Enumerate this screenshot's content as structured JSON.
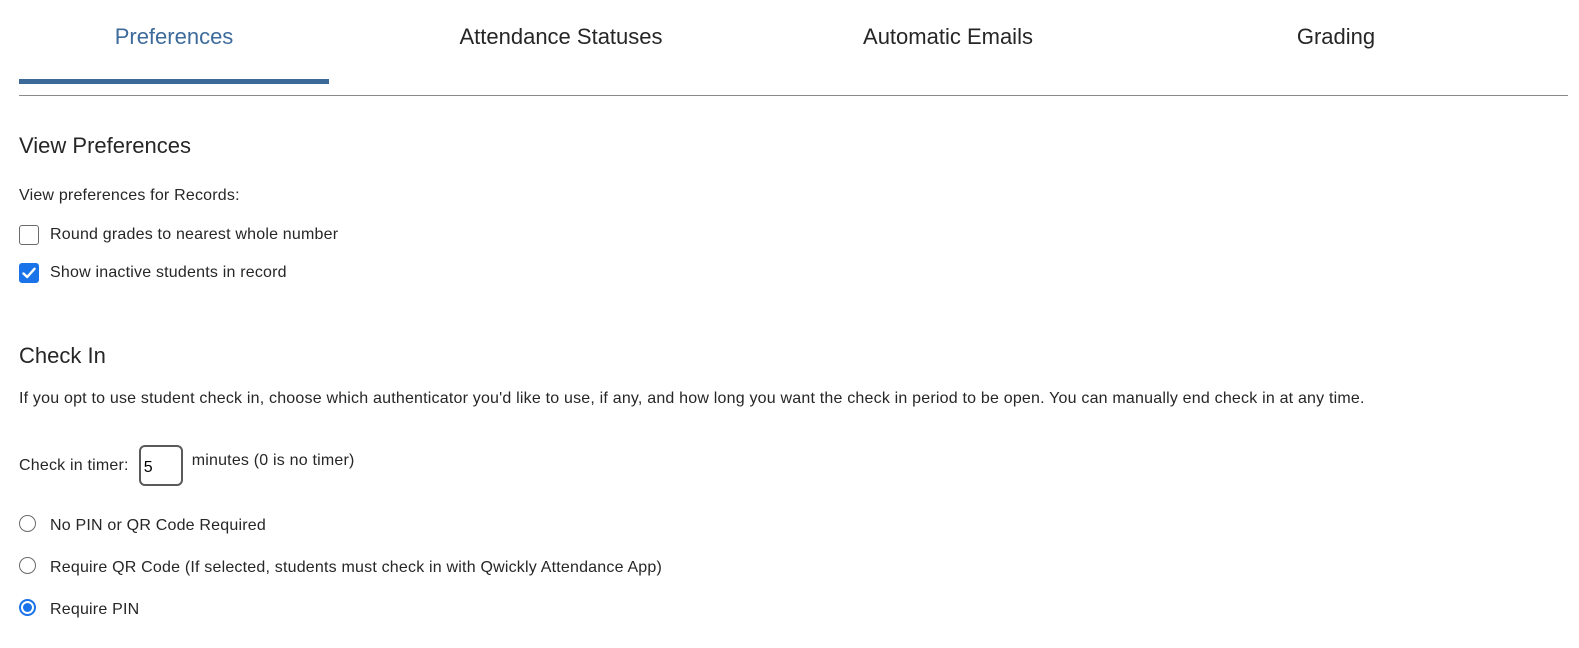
{
  "tabs": [
    {
      "label": "Preferences",
      "active": true
    },
    {
      "label": "Attendance Statuses",
      "active": false
    },
    {
      "label": "Automatic Emails",
      "active": false
    },
    {
      "label": "Grading",
      "active": false
    }
  ],
  "view_preferences": {
    "heading": "View Preferences",
    "subtitle": "View preferences for Records:",
    "options": [
      {
        "label": "Round grades to nearest whole number",
        "checked": false
      },
      {
        "label": "Show inactive students in record",
        "checked": true
      }
    ]
  },
  "check_in": {
    "heading": "Check In",
    "description": "If you opt to use student check in, choose which authenticator you'd like to use, if any, and how long you want the check in period to be open. You can manually end check in at any time.",
    "timer_label": "Check in timer:",
    "timer_value": "5",
    "timer_suffix": "minutes (0 is no timer)",
    "auth_options": [
      {
        "label": "No PIN or QR Code Required",
        "selected": false
      },
      {
        "label": "Require QR Code (If selected, students must check in with Qwickly Attendance App)",
        "selected": false
      },
      {
        "label": "Require PIN",
        "selected": true
      }
    ]
  },
  "colors": {
    "accent": "#3b6a98",
    "active_tab_text": "#3d6b9b",
    "control_blue": "#1a73e8"
  }
}
